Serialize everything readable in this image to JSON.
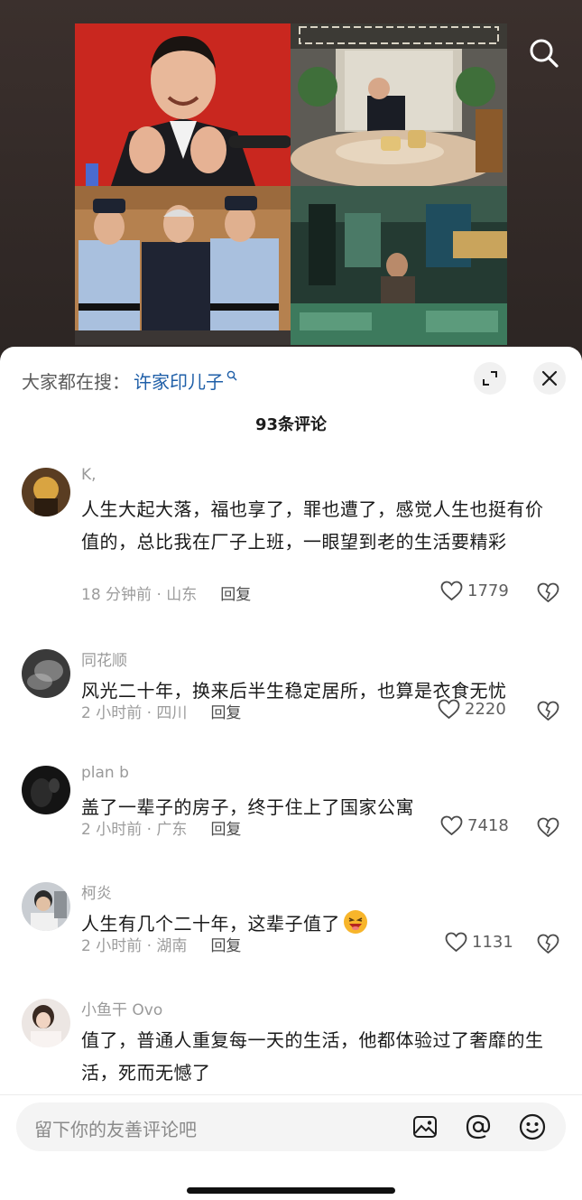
{
  "hot_search": {
    "prefix": "大家都在搜：",
    "term": "许家印儿子"
  },
  "comment_count": "93条评论",
  "comments": [
    {
      "user": "K,",
      "text": "人生大起大落，福也享了，罪也遭了，感觉人生也挺有价值的，总比我在厂子上班，一眼望到老的生活要精彩",
      "time_location": "18 分钟前 · 山东",
      "reply": "回复",
      "likes": "1779"
    },
    {
      "user": "同花顺",
      "text": "风光二十年，换来后半生稳定居所，也算是衣食无忧",
      "time_location": "2 小时前 · 四川",
      "reply": "回复",
      "likes": "2220"
    },
    {
      "user": "plan b",
      "text": "盖了一辈子的房子，终于住上了国家公寓",
      "time_location": "2 小时前 · 广东",
      "reply": "回复",
      "likes": "7418"
    },
    {
      "user": "柯炎",
      "text": "人生有几个二十年，这辈子值了",
      "time_location": "2 小时前 · 湖南",
      "reply": "回复",
      "likes": "1131"
    },
    {
      "user": "小鱼干 Ovo",
      "text": "值了，普通人重复每一天的生活，他都体验过了奢靡的生活，死而无憾了"
    }
  ],
  "input": {
    "placeholder": "留下你的友善评论吧"
  },
  "icons": {
    "top_search": "search-icon",
    "expand": "expand-icon",
    "close": "close-icon",
    "like": "heart-icon",
    "dislike": "broken-heart-icon",
    "image": "image-icon",
    "mention": "at-icon",
    "emoji": "smile-icon"
  },
  "colors": {
    "link_blue": "#1f5fa8",
    "sheet_bg": "#ffffff",
    "muted_text": "#9a9a9a"
  }
}
